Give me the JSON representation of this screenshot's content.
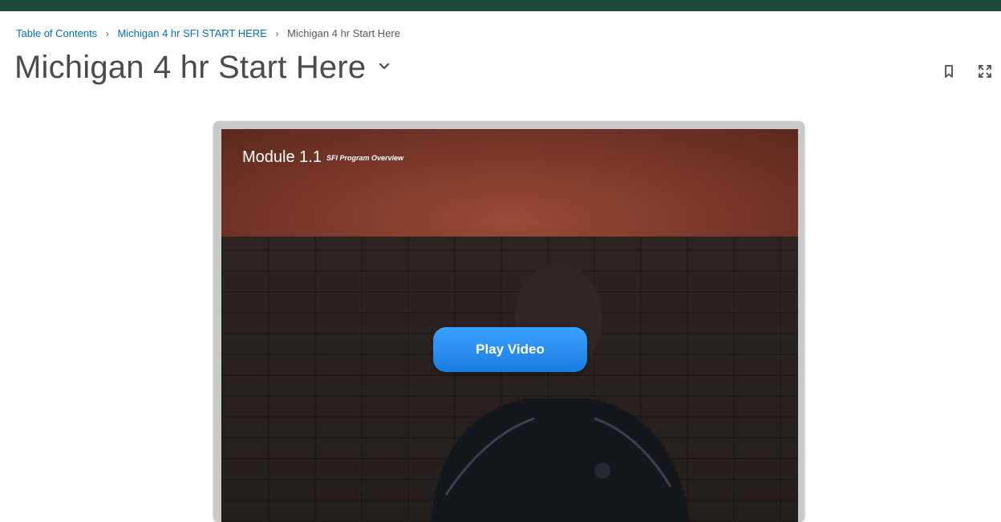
{
  "breadcrumb": {
    "items": [
      {
        "label": "Table of Contents"
      },
      {
        "label": "Michigan 4 hr SFI START HERE"
      }
    ],
    "current": "Michigan 4 hr Start Here",
    "separator": "›"
  },
  "page": {
    "title": "Michigan 4 hr Start Here"
  },
  "toolbar": {
    "bookmark_icon": "bookmark-icon",
    "fullscreen_icon": "fullscreen-icon"
  },
  "player": {
    "module_label": "Module 1.1",
    "module_subtitle": "SFI Program Overview",
    "play_label": "Play Video"
  },
  "colors": {
    "topbar": "#1d4b3b",
    "link": "#006fbf",
    "banner": "#8a4030",
    "play_button": "#2b8ef0"
  }
}
